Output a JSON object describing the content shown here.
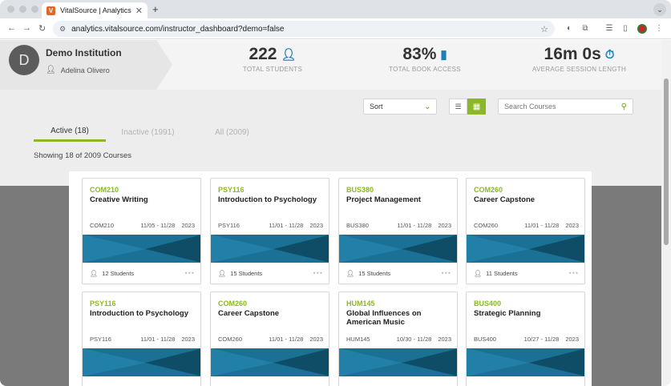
{
  "browser": {
    "tab_title": "VitalSource | Analytics",
    "favicon_letter": "V",
    "url": "analytics.vitalsource.com/instructor_dashboard?demo=false"
  },
  "institution": {
    "avatar_letter": "D",
    "name": "Demo Institution",
    "user": "Adelina Olivero"
  },
  "stats": [
    {
      "value": "222",
      "label": "TOTAL STUDENTS",
      "icon": "person-icon"
    },
    {
      "value": "83%",
      "label": "TOTAL BOOK ACCESS",
      "icon": "book-icon"
    },
    {
      "value": "16m 0s",
      "label": "AVERAGE SESSION LENGTH",
      "icon": "stopwatch-icon"
    }
  ],
  "toolbar": {
    "sort_label": "Sort",
    "search_placeholder": "Search Courses"
  },
  "filter_tabs": [
    {
      "label": "Active (18)",
      "active": true
    },
    {
      "label": "Inactive (1991)",
      "active": false
    },
    {
      "label": "All (2009)",
      "active": false
    }
  ],
  "showing_text": "Showing 18 of 2009 Courses",
  "colors": {
    "accent_green": "#8cb825",
    "banner_teal": "#1b7195",
    "banner_dark": "#0f4d66",
    "stat_icon_blue": "#1e7fb5"
  },
  "courses": [
    {
      "code": "COM210",
      "name": "Creative Writing",
      "meta_code": "COM210",
      "dates": "11/05 - 11/28",
      "year": "2023",
      "students": "12 Students"
    },
    {
      "code": "PSY116",
      "name": "Introduction to Psychology",
      "meta_code": "PSY116",
      "dates": "11/01 - 11/28",
      "year": "2023",
      "students": "15 Students"
    },
    {
      "code": "BUS380",
      "name": "Project Management",
      "meta_code": "BUS380",
      "dates": "11/01 - 11/28",
      "year": "2023",
      "students": "15 Students"
    },
    {
      "code": "COM260",
      "name": "Career Capstone",
      "meta_code": "COM260",
      "dates": "11/01 - 11/28",
      "year": "2023",
      "students": "11 Students"
    },
    {
      "code": "PSY116",
      "name": "Introduction to Psychology",
      "meta_code": "PSY116",
      "dates": "11/01 - 11/28",
      "year": "2023",
      "students": ""
    },
    {
      "code": "COM260",
      "name": "Career Capstone",
      "meta_code": "COM260",
      "dates": "11/01 - 11/28",
      "year": "2023",
      "students": ""
    },
    {
      "code": "HUM145",
      "name": "Global Influences on American Music",
      "meta_code": "HUM145",
      "dates": "10/30 - 11/28",
      "year": "2023",
      "students": ""
    },
    {
      "code": "BUS400",
      "name": "Strategic Planning",
      "meta_code": "BUS400",
      "dates": "10/27 - 11/28",
      "year": "2023",
      "students": ""
    }
  ]
}
